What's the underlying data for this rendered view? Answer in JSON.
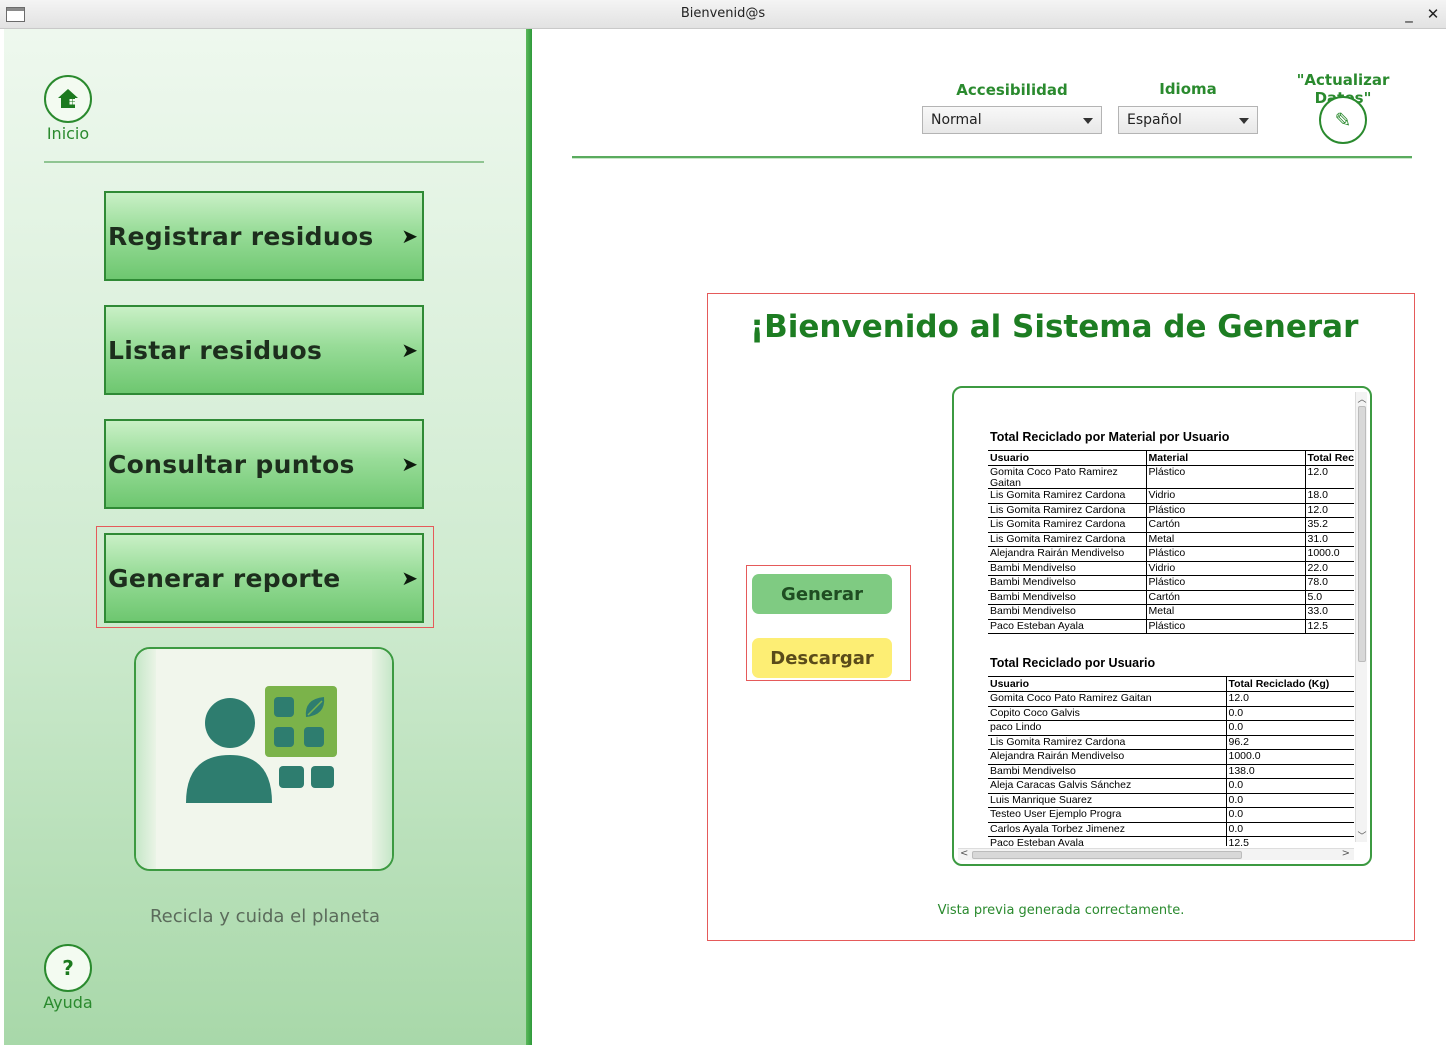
{
  "window": {
    "title": "Bienvenid@s",
    "minimize": "_",
    "close": "✕"
  },
  "sidebar": {
    "home": {
      "label": "Inicio",
      "icon": "home-icon"
    },
    "help": {
      "label": "Ayuda",
      "symbol": "?",
      "icon": "help-icon"
    },
    "items": [
      {
        "label": "Registrar residuos",
        "arrow": "➤"
      },
      {
        "label": "Listar residuos",
        "arrow": "➤"
      },
      {
        "label": "Consultar puntos",
        "arrow": "➤"
      },
      {
        "label": "Generar reporte",
        "arrow": "➤",
        "selected": true
      }
    ],
    "illustration": "user-recycling-grid-icon",
    "tagline": "Recicla y cuida el planeta"
  },
  "header": {
    "accessibility": {
      "label": "Accesibilidad",
      "value": "Normal"
    },
    "language": {
      "label": "Idioma",
      "value": "Español"
    },
    "update": {
      "label": "\"Actualizar Datos\"",
      "icon": "pencil-icon",
      "symbol": "✎"
    }
  },
  "main": {
    "title": "¡Bienvenido al Sistema de Generar R...",
    "generate_label": "Generar",
    "download_label": "Descargar",
    "status": "Vista previa generada correctamente."
  },
  "report": {
    "by_material": {
      "title": "Total Reciclado por Material por Usuario",
      "columns": [
        "Usuario",
        "Material",
        "Total Rec"
      ],
      "rows": [
        [
          "Gomita Coco Pato Ramirez Gaitan",
          "Plástico",
          "12.0"
        ],
        [
          "Lis Gomita Ramirez Cardona",
          "Vidrio",
          "18.0"
        ],
        [
          "Lis Gomita Ramirez Cardona",
          "Plástico",
          "12.0"
        ],
        [
          "Lis Gomita Ramirez Cardona",
          "Cartón",
          "35.2"
        ],
        [
          "Lis Gomita Ramirez Cardona",
          "Metal",
          "31.0"
        ],
        [
          "Alejandra Rairán Mendivelso",
          "Plástico",
          "1000.0"
        ],
        [
          "Bambi Mendivelso",
          "Vidrio",
          "22.0"
        ],
        [
          "Bambi Mendivelso",
          "Plástico",
          "78.0"
        ],
        [
          "Bambi Mendivelso",
          "Cartón",
          "5.0"
        ],
        [
          "Bambi Mendivelso",
          "Metal",
          "33.0"
        ],
        [
          "Paco Esteban Ayala",
          "Plástico",
          "12.5"
        ]
      ]
    },
    "by_user": {
      "title": "Total Reciclado por Usuario",
      "columns": [
        "Usuario",
        "Total Reciclado (Kg)"
      ],
      "rows": [
        [
          "Gomita Coco Pato Ramirez Gaitan",
          "12.0"
        ],
        [
          "Copito Coco Galvis",
          "0.0"
        ],
        [
          "paco Lindo",
          "0.0"
        ],
        [
          "Lis Gomita Ramirez Cardona",
          "96.2"
        ],
        [
          "Alejandra Rairán Mendivelso",
          "1000.0"
        ],
        [
          "Bambi Mendivelso",
          "138.0"
        ],
        [
          "Aleja Caracas Galvis Sánchez",
          "0.0"
        ],
        [
          "Luis Manrique Suarez",
          "0.0"
        ],
        [
          "Testeo User Ejemplo Progra",
          "0.0"
        ],
        [
          "Carlos Ayala Torbez Jimenez",
          "0.0"
        ],
        [
          "Paco Esteban Ayala",
          "12.5"
        ]
      ]
    }
  },
  "colors": {
    "accent": "#2a8a2e",
    "title_green": "#1d7d22",
    "generate": "#7fcb82",
    "download": "#fdee74",
    "highlight": "#e55a5a"
  }
}
